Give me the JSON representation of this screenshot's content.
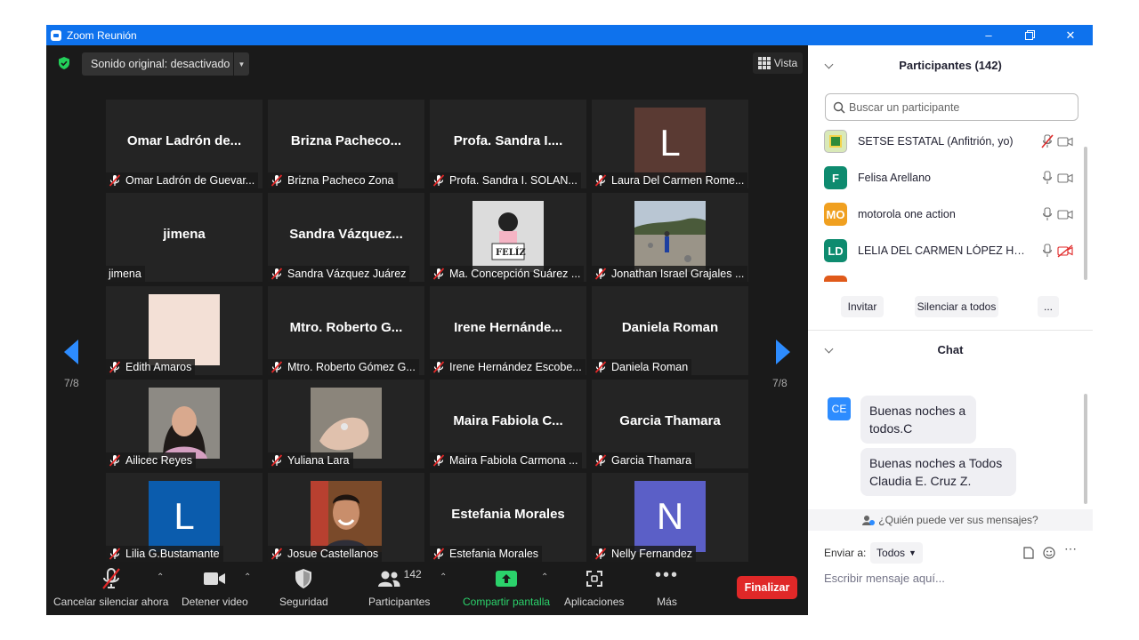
{
  "window": {
    "title": "Zoom Reunión"
  },
  "stage": {
    "sound_label": "Sonido original: desactivado",
    "view_label": "Vista",
    "page_left": "7/8",
    "page_right": "7/8"
  },
  "tiles": [
    {
      "big": "Omar Ladrón de...",
      "caption": "Omar Ladrón de Guevar..."
    },
    {
      "big": "Brizna  Pacheco...",
      "caption": "Brizna Pacheco Zona"
    },
    {
      "big": "Profa. Sandra I....",
      "caption": "Profa. Sandra I. SOLAN..."
    },
    {
      "avatar": "L",
      "avatar_color": "#5a3a33",
      "caption": "Laura Del Carmen Rome..."
    },
    {
      "big": "jimena",
      "caption": "jimena",
      "unmuted": true
    },
    {
      "big": "Sandra  Vázquez...",
      "caption": "Sandra Vázquez Juárez"
    },
    {
      "photo": "card",
      "photo_text": "FELÍZ",
      "caption": "Ma. Concepción Suárez ..."
    },
    {
      "photo": "landscape",
      "caption": "Jonathan Israel Grajales ..."
    },
    {
      "photo": "blank",
      "caption": "Edith Amaros"
    },
    {
      "big": "Mtro.  Roberto  G...",
      "caption": "Mtro. Roberto Gómez G..."
    },
    {
      "big": "Irene  Hernánde...",
      "caption": "Irene Hernández Escobe..."
    },
    {
      "big": "Daniela Roman",
      "caption": "Daniela Roman"
    },
    {
      "photo": "woman",
      "caption": "Ailicec Reyes"
    },
    {
      "photo": "hand",
      "caption": "Yuliana Lara"
    },
    {
      "big": "Maira  Fabiola  C...",
      "caption": "Maira Fabiola Carmona ..."
    },
    {
      "big": "Garcia Thamara",
      "caption": "Garcia Thamara"
    },
    {
      "avatar": "L",
      "avatar_color": "#0b5cad",
      "caption": "Lilia G.Bustamante"
    },
    {
      "photo": "man",
      "caption": "Josue Castellanos"
    },
    {
      "big": "Estefania Morales",
      "caption": "Estefania Morales"
    },
    {
      "avatar": "N",
      "avatar_color": "#5b5fc7",
      "caption": "Nelly Fernandez"
    }
  ],
  "toolbar": {
    "unmute": "Cancelar silenciar ahora",
    "video": "Detener video",
    "security": "Seguridad",
    "participants": "Participantes",
    "participants_count": "142",
    "share": "Compartir pantalla",
    "apps": "Aplicaciones",
    "more": "Más",
    "end": "Finalizar",
    "accent_share": "#2bd26b",
    "end_color": "#e02828"
  },
  "participants_panel": {
    "title": "Participantes (142)",
    "search_placeholder": "Buscar un participante",
    "list": [
      {
        "initials": "",
        "name": "SETSE ESTATAL (Anfitrión, yo)",
        "color": "#d9e9b8",
        "mic": "muted",
        "cam": "on"
      },
      {
        "initials": "F",
        "name": "Felisa Arellano",
        "color": "#0e8b6f",
        "mic": "on",
        "cam": "on"
      },
      {
        "initials": "MO",
        "name": "motorola one action",
        "color": "#f0a020",
        "mic": "on",
        "cam": "on"
      },
      {
        "initials": "LD",
        "name": "LELIA DEL CARMEN LÓPEZ HUE...",
        "color": "#0e8b6f",
        "mic": "on",
        "cam": "off"
      }
    ],
    "invite": "Invitar",
    "mute_all": "Silenciar a todos",
    "more": "..."
  },
  "chat": {
    "title": "Chat",
    "sender_initials": "CE",
    "messages": [
      "Buenas noches a todos.C",
      "Buenas noches a Todos Claudia E. Cruz Z."
    ],
    "who_can_see": "¿Quién puede ver sus mensajes?",
    "send_to_label": "Enviar a:",
    "send_to_value": "Todos",
    "input_placeholder": "Escribir mensaje aquí..."
  }
}
